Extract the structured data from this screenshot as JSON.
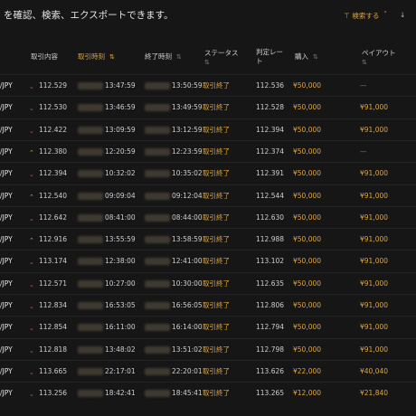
{
  "topbar": {
    "description": "を確認、検索、エクスポートできます。",
    "filter_label": "検索する",
    "download_label": "↓"
  },
  "table": {
    "headers": {
      "content": "取引内容",
      "trade_time": "取引時刻",
      "end_time": "終了時刻",
      "status": "ステータス",
      "judge_rate_line1": "判定レー",
      "judge_rate_line2": "ト",
      "purchase": "購入",
      "payout": "ペイアウト"
    },
    "rows": [
      {
        "pair": "/JPY",
        "direction": "down",
        "rate": "112.529",
        "trade_time": "13:47:59",
        "end_time": "13:50:59",
        "status": "取引終了",
        "judge_rate": "112.536",
        "amount": "¥50,000",
        "payout": "—"
      },
      {
        "pair": "/JPY",
        "direction": "down",
        "rate": "112.530",
        "trade_time": "13:46:59",
        "end_time": "13:49:59",
        "status": "取引終了",
        "judge_rate": "112.528",
        "amount": "¥50,000",
        "payout": "¥91,000"
      },
      {
        "pair": "/JPY",
        "direction": "down",
        "rate": "112.422",
        "trade_time": "13:09:59",
        "end_time": "13:12:59",
        "status": "取引終了",
        "judge_rate": "112.394",
        "amount": "¥50,000",
        "payout": "¥91,000"
      },
      {
        "pair": "/JPY",
        "direction": "up",
        "rate": "112.380",
        "trade_time": "12:20:59",
        "end_time": "12:23:59",
        "status": "取引終了",
        "judge_rate": "112.374",
        "amount": "¥50,000",
        "payout": "—"
      },
      {
        "pair": "/JPY",
        "direction": "down",
        "rate": "112.394",
        "trade_time": "10:32:02",
        "end_time": "10:35:02",
        "status": "取引終了",
        "judge_rate": "112.391",
        "amount": "¥50,000",
        "payout": "¥91,000"
      },
      {
        "pair": "/JPY",
        "direction": "up",
        "rate": "112.540",
        "trade_time": "09:09:04",
        "end_time": "09:12:04",
        "status": "取引終了",
        "judge_rate": "112.544",
        "amount": "¥50,000",
        "payout": "¥91,000"
      },
      {
        "pair": "/JPY",
        "direction": "down",
        "rate": "112.642",
        "trade_time": "08:41:00",
        "end_time": "08:44:00",
        "status": "取引終了",
        "judge_rate": "112.630",
        "amount": "¥50,000",
        "payout": "¥91,000"
      },
      {
        "pair": "/JPY",
        "direction": "up",
        "rate": "112.916",
        "trade_time": "13:55:59",
        "end_time": "13:58:59",
        "status": "取引終了",
        "judge_rate": "112.988",
        "amount": "¥50,000",
        "payout": "¥91,000"
      },
      {
        "pair": "/JPY",
        "direction": "down",
        "rate": "113.174",
        "trade_time": "12:38:00",
        "end_time": "12:41:00",
        "status": "取引終了",
        "judge_rate": "113.102",
        "amount": "¥50,000",
        "payout": "¥91,000"
      },
      {
        "pair": "/JPY",
        "direction": "down",
        "rate": "112.571",
        "trade_time": "10:27:00",
        "end_time": "10:30:00",
        "status": "取引終了",
        "judge_rate": "112.635",
        "amount": "¥50,000",
        "payout": "¥91,000"
      },
      {
        "pair": "/JPY",
        "direction": "down",
        "rate": "112.834",
        "trade_time": "16:53:05",
        "end_time": "16:56:05",
        "status": "取引終了",
        "judge_rate": "112.806",
        "amount": "¥50,000",
        "payout": "¥91,000"
      },
      {
        "pair": "/JPY",
        "direction": "down",
        "rate": "112.854",
        "trade_time": "16:11:00",
        "end_time": "16:14:00",
        "status": "取引終了",
        "judge_rate": "112.794",
        "amount": "¥50,000",
        "payout": "¥91,000"
      },
      {
        "pair": "/JPY",
        "direction": "down",
        "rate": "112.818",
        "trade_time": "13:48:02",
        "end_time": "13:51:02",
        "status": "取引終了",
        "judge_rate": "112.798",
        "amount": "¥50,000",
        "payout": "¥91,000"
      },
      {
        "pair": "/JPY",
        "direction": "down",
        "rate": "113.665",
        "trade_time": "22:17:01",
        "end_time": "22:20:01",
        "status": "取引終了",
        "judge_rate": "113.626",
        "amount": "¥22,000",
        "payout": "¥40,040"
      },
      {
        "pair": "/JPY",
        "direction": "down",
        "rate": "113.256",
        "trade_time": "18:42:41",
        "end_time": "18:45:41",
        "status": "取引終了",
        "judge_rate": "113.265",
        "amount": "¥12,000",
        "payout": "¥21,840"
      }
    ]
  },
  "colors": {
    "accent": "#e0a53a",
    "down": "#e2553e",
    "up": "#9fd33a",
    "background": "#161616"
  },
  "icons": {
    "down": "chevron-down-icon",
    "up": "chevron-up-icon",
    "filter": "filter-icon",
    "download": "download-icon"
  }
}
